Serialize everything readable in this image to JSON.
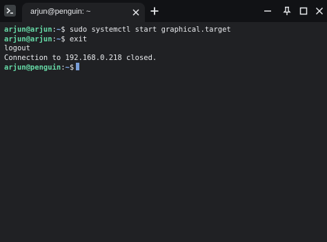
{
  "titlebar": {
    "tab_title": "arjun@penguin: ~"
  },
  "icons": {
    "app": "terminal-icon",
    "close_tab": "close-icon",
    "new_tab": "plus-icon",
    "minimize": "minimize-icon",
    "pin": "pin-icon",
    "maximize": "maximize-icon",
    "close_window": "close-icon"
  },
  "terminal": {
    "lines": [
      {
        "user": "arjun@arjun",
        "path": "~",
        "prompt_end": "$",
        "command": " sudo systemctl start graphical.target"
      },
      {
        "user": "arjun@arjun",
        "path": "~",
        "prompt_end": "$",
        "command": " exit"
      },
      {
        "text": "logout"
      },
      {
        "text": "Connection to 192.168.0.218 closed."
      },
      {
        "user": "arjun@penguin",
        "path": "~",
        "prompt_end": "$",
        "command": " "
      }
    ]
  },
  "colors": {
    "background": "#202124",
    "titlebar": "#111215",
    "user": "#66d9a6",
    "path": "#8ab4f8",
    "text": "#e8eaed",
    "cursor": "#8ab4f8"
  }
}
